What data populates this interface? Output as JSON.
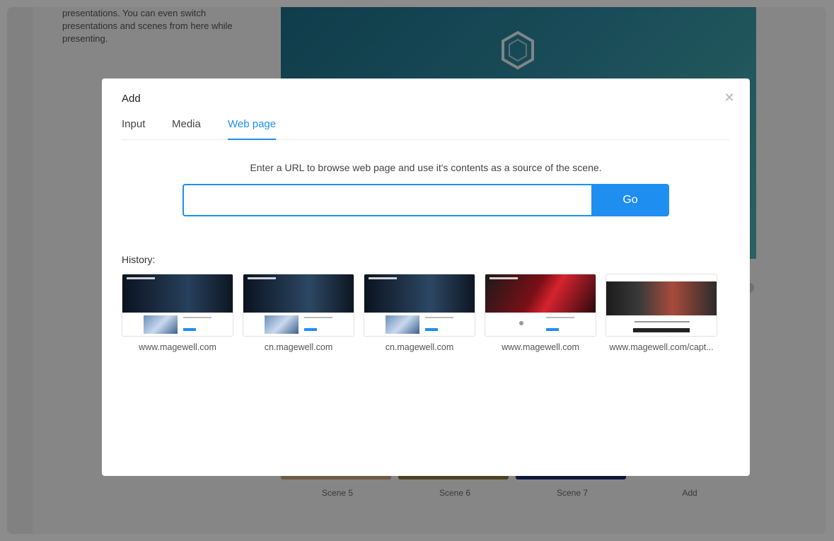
{
  "background": {
    "description": "presentations. You can even switch presentations and scenes from here while presenting.",
    "scenes": [
      {
        "label": "Scene 5"
      },
      {
        "label": "Scene 6"
      },
      {
        "label": "Scene 7"
      },
      {
        "label": "Add"
      }
    ],
    "colors": {
      "preview_start": "#1d6f87",
      "preview_end": "#4fb2b2"
    }
  },
  "modal": {
    "title": "Add",
    "close_icon": "close-icon",
    "tabs": [
      {
        "label": "Input",
        "active": false
      },
      {
        "label": "Media",
        "active": false
      },
      {
        "label": "Web page",
        "active": true
      }
    ],
    "hint": "Enter a URL to browse web page and use it's contents as a source of the scene.",
    "url_input": {
      "value": "",
      "placeholder": ""
    },
    "go_label": "Go",
    "history_label": "History:",
    "history": [
      {
        "caption": "www.magewell.com",
        "theme": "dark"
      },
      {
        "caption": "cn.magewell.com",
        "theme": "dark"
      },
      {
        "caption": "cn.magewell.com",
        "theme": "dark"
      },
      {
        "caption": "www.magewell.com",
        "theme": "red"
      },
      {
        "caption": "www.magewell.com/capt...",
        "theme": "light"
      }
    ],
    "colors": {
      "accent": "#1f8ef1"
    }
  }
}
